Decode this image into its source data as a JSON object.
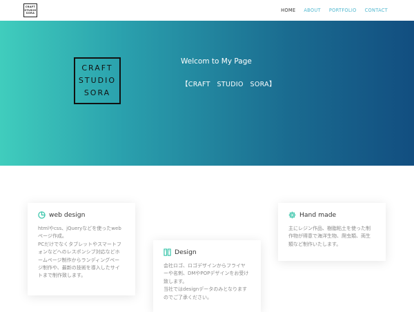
{
  "nav": {
    "logo_lines": [
      "CRAFT",
      "STUDIO",
      "SORA"
    ],
    "links": [
      {
        "label": "HOME",
        "active": true
      },
      {
        "label": "ABOUT",
        "active": false
      },
      {
        "label": "PORTFOLIO",
        "active": false
      },
      {
        "label": "CONTACT",
        "active": false
      }
    ]
  },
  "hero": {
    "logo_lines": [
      "CRAFT",
      "STUDIO",
      "SORA"
    ],
    "welcome": "Welcom to My Page",
    "subtitle": "【CRAFT　STUDIO　SORA】",
    "gradient": [
      "#40cdbd",
      "#124e80"
    ]
  },
  "cards": [
    {
      "icon": "pie-chart-icon",
      "title": "web design",
      "text": "htmlやcss、jQueryなどを使ったwebページ作成。\nPCだけでなくタブレットやスマートフォンなどへのレスポンシブ対応などホームページ制作からランディングページ制作や、最新の技術を導入したサイトまで制作致します。"
    },
    {
      "icon": "columns-icon",
      "title": "Design",
      "text": "会社ロゴ、ロゴデザインからフライヤーや名刺、DMやPOPデザインをお受け致します。\n当社ではdesignデータのみとなりますのでご了承ください。"
    },
    {
      "icon": "gear-icon",
      "title": "Hand made",
      "text": "主にレジン作品、樹脂粘土を使った制作物が得意で海洋生物、爬虫類、両生類など制作いたします。"
    }
  ],
  "colors": {
    "accent": "#2bc1a4",
    "nav_link": "#4fb7cf"
  }
}
